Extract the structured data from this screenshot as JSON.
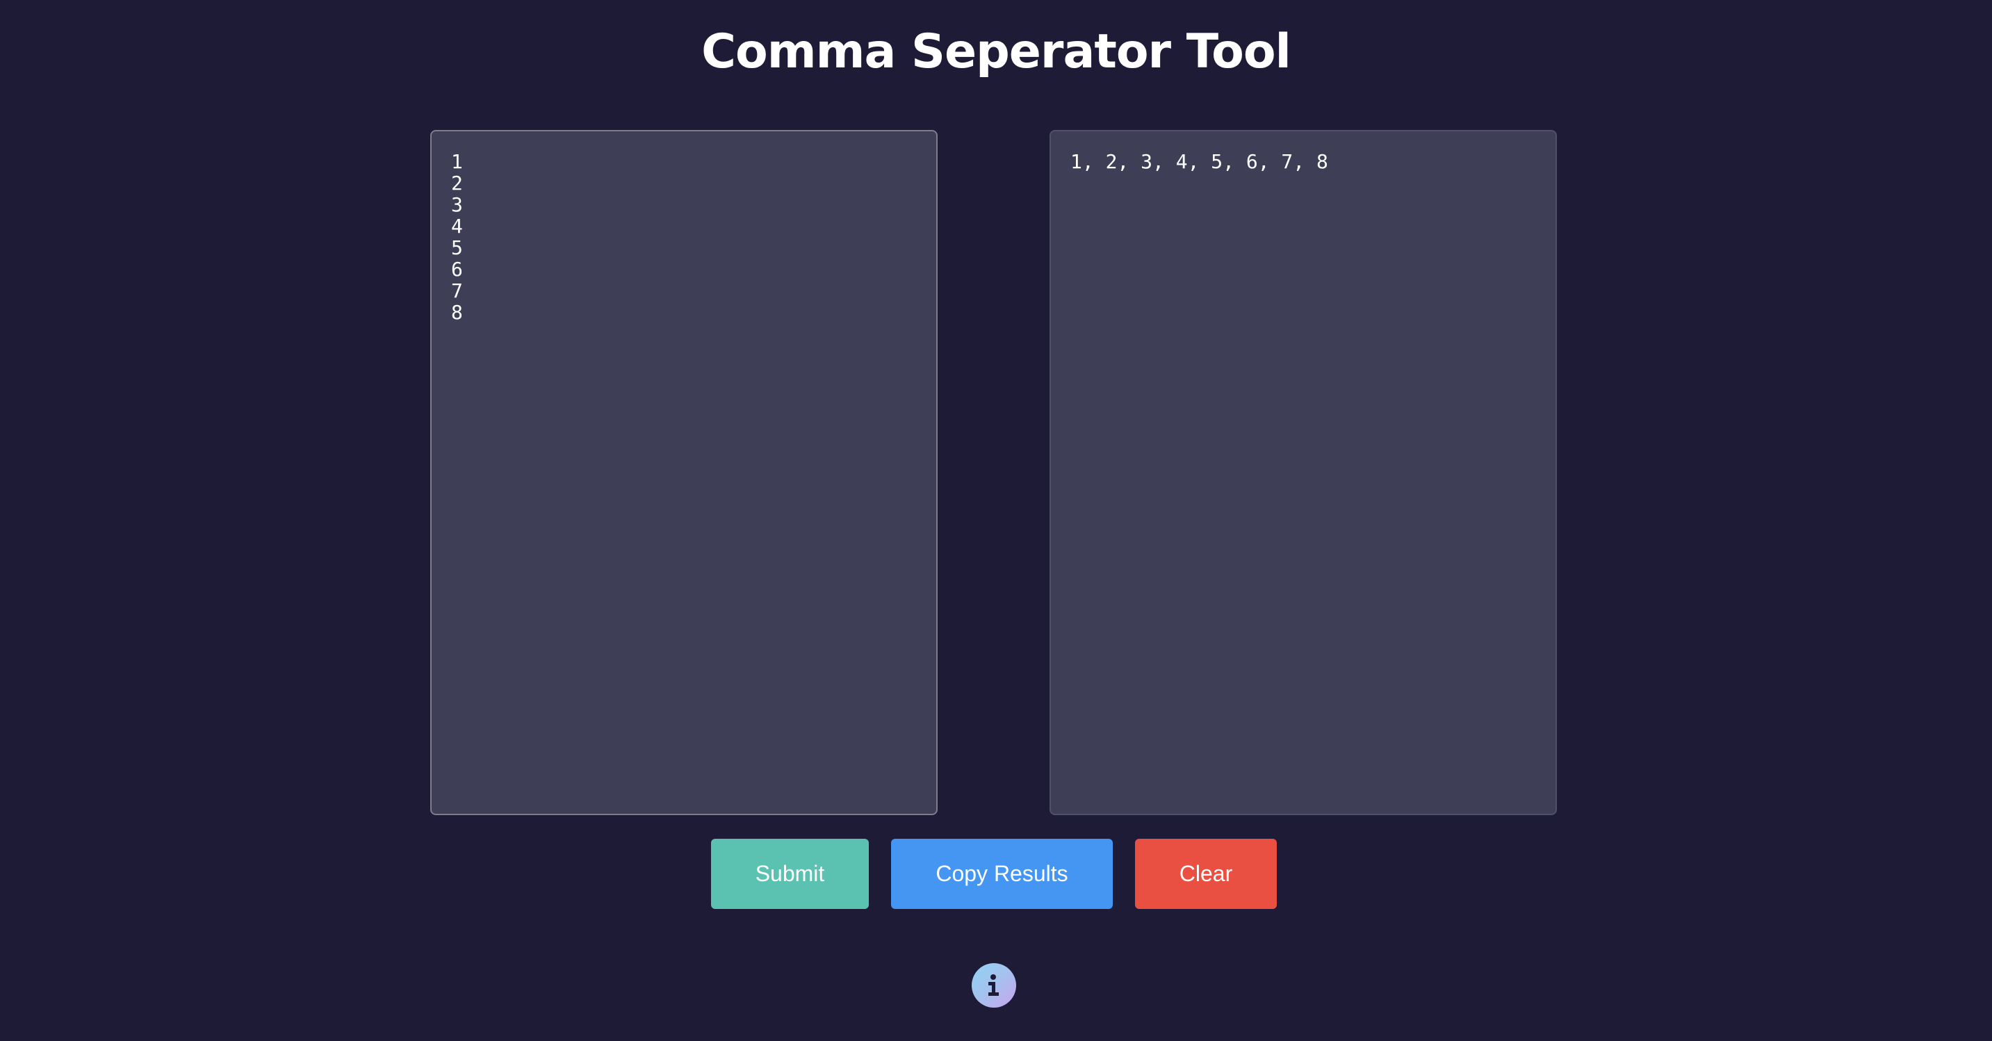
{
  "page": {
    "title": "Comma Seperator Tool"
  },
  "input": {
    "value": "1\n2\n3\n4\n5\n6\n7\n8"
  },
  "output": {
    "value": "1, 2, 3, 4, 5, 6, 7, 8"
  },
  "buttons": {
    "submit_label": "Submit",
    "copy_label": "Copy Results",
    "clear_label": "Clear"
  },
  "icons": {
    "info": "info-icon"
  },
  "colors": {
    "background": "#1e1b37",
    "panel": "#3e3f56",
    "submit": "#5bc2b2",
    "copy": "#4496f2",
    "clear": "#e95041"
  }
}
